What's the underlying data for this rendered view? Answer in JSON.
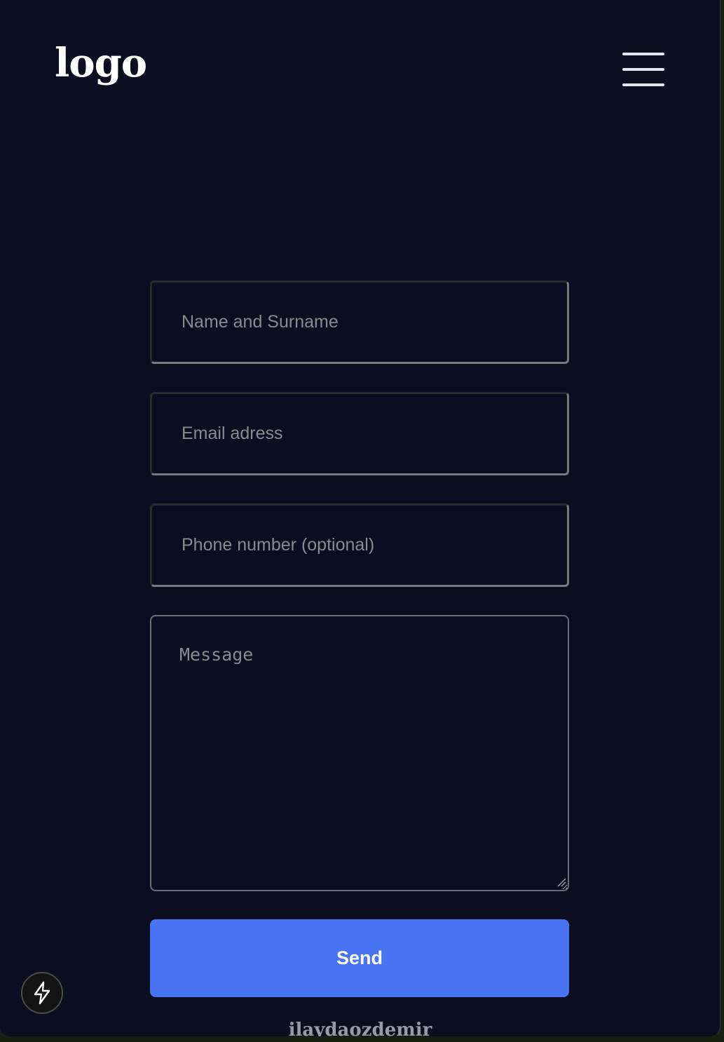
{
  "header": {
    "logo_text": "logo",
    "menu_icon": "hamburger-menu-icon"
  },
  "form": {
    "name_placeholder": "Name and Surname",
    "email_placeholder": "Email adress",
    "phone_placeholder": "Phone number (optional)",
    "message_placeholder": "Message",
    "send_label": "Send"
  },
  "footer": {
    "author": "ilaydaozdemir"
  },
  "floating": {
    "icon": "lightning-bolt-icon"
  },
  "colors": {
    "background": "#0d0d21",
    "accent": "#4873f2",
    "text": "#ffffff",
    "placeholder": "#8a8a90"
  }
}
